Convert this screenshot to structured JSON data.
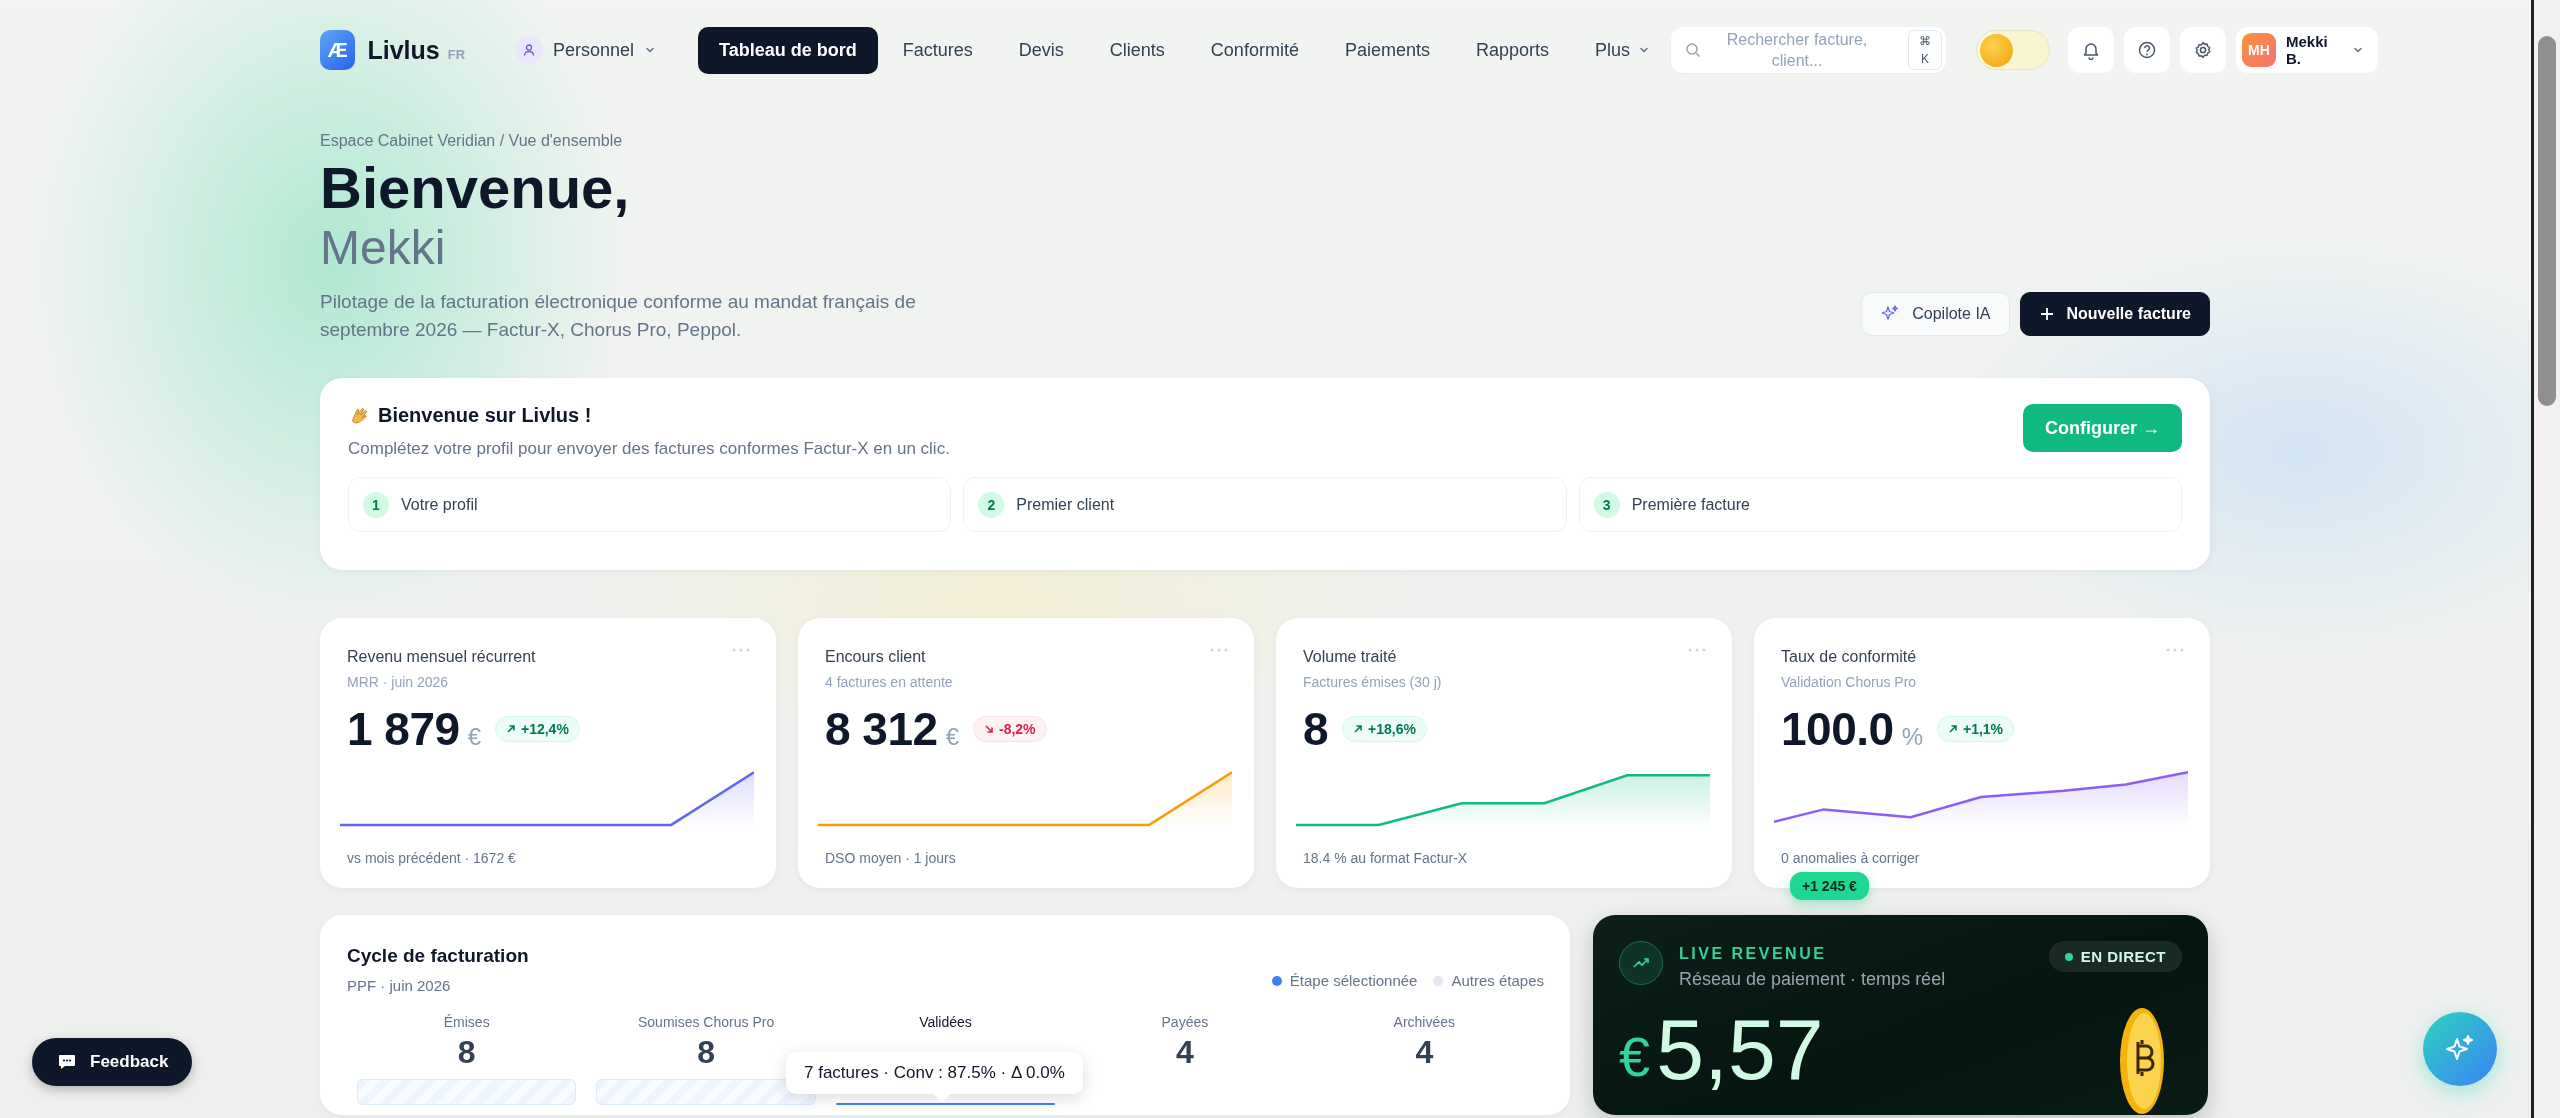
{
  "brand": {
    "logo": "Æ",
    "name": "Livlus",
    "locale": "FR"
  },
  "workspace": {
    "label": "Personnel"
  },
  "nav": [
    {
      "label": "Tableau de bord",
      "selected": true,
      "kind": "link"
    },
    {
      "label": "Factures",
      "selected": false,
      "kind": "link"
    },
    {
      "label": "Devis",
      "selected": false,
      "kind": "link"
    },
    {
      "label": "Clients",
      "selected": false,
      "kind": "link"
    },
    {
      "label": "Conformité",
      "selected": false,
      "kind": "link"
    },
    {
      "label": "Paiements",
      "selected": false,
      "kind": "link"
    },
    {
      "label": "Rapports",
      "selected": false,
      "kind": "link"
    },
    {
      "label": "Plus",
      "selected": false,
      "kind": "menu"
    }
  ],
  "search": {
    "placeholder": "Rechercher facture, client...",
    "shortcut": "⌘ K"
  },
  "theme_toggle": {
    "on": false
  },
  "user": {
    "initials": "MH",
    "name": "Mekki B."
  },
  "header": {
    "breadcrumb": "Espace Cabinet Veridian / Vue d'ensemble",
    "title": "Bienvenue,",
    "name": "Mekki",
    "description": "Pilotage de la facturation électronique conforme au mandat français de septembre 2026 — Factur-X, Chorus Pro, Peppol.",
    "actions": [
      {
        "label": "Copilote IA",
        "kind": "secondary"
      },
      {
        "label": "Nouvelle facture",
        "kind": "primary"
      }
    ]
  },
  "onboarding": {
    "title": "Bienvenue sur Livlus !",
    "subtitle": "Complétez votre profil pour envoyer des factures conformes Factur-X en un clic.",
    "button": "Configurer →",
    "steps": [
      {
        "number": "1",
        "label": "Votre profil"
      },
      {
        "number": "2",
        "label": "Premier client"
      },
      {
        "number": "3",
        "label": "Première facture"
      }
    ]
  },
  "kpis": [
    {
      "title": "Revenu mensuel récurrent",
      "subtitle": "MRR · juin 2026",
      "value": "1 879",
      "unit": "€",
      "delta": "+12,4%",
      "kind": "up",
      "footer": "vs mois précédent · 1672 €",
      "color": "#6366f1"
    },
    {
      "title": "Encours client",
      "subtitle": "4 factures en attente",
      "value": "8 312",
      "unit": "€",
      "delta": "-8,2%",
      "kind": "down",
      "footer": "DSO moyen · 1 jours",
      "color": "#f59e0b"
    },
    {
      "title": "Volume traité",
      "subtitle": "Factures émises (30 j)",
      "value": "8",
      "delta": "+18,6%",
      "kind": "up",
      "footer": "18.4 % au format Factur-X",
      "color": "#10b981"
    },
    {
      "title": "Taux de conformité",
      "subtitle": "Validation Chorus Pro",
      "value": "100.0",
      "unit": "%",
      "delta": "+1,1%",
      "kind": "up",
      "footer": "0 anomalies à corriger",
      "color": "#8b5cf6"
    }
  ],
  "floating_badge": "+1 245 €",
  "cycle": {
    "title": "Cycle de facturation",
    "subtitle": "PPF · juin 2026",
    "legend": [
      {
        "label": "Étape sélectionnée",
        "color": "#3b82f6"
      },
      {
        "label": "Autres étapes",
        "color": "#e2e8f0"
      }
    ],
    "stages": [
      {
        "label": "Émises",
        "value": "8",
        "selected": false
      },
      {
        "label": "Soumises Chorus Pro",
        "value": "8",
        "selected": false
      },
      {
        "label": "Validées",
        "selected": true
      },
      {
        "label": "Payées",
        "value": "4",
        "selected": false
      },
      {
        "label": "Archivées",
        "value": "4",
        "selected": false
      }
    ],
    "tooltip": "7 factures · Conv : 87.5% · Δ 0.0%"
  },
  "live": {
    "label": "LIVE REVENUE",
    "subtitle": "Réseau de paiement · temps réel",
    "status": "EN DIRECT",
    "currency": "€",
    "amount": "5,57"
  },
  "feedback": {
    "label": "Feedback"
  }
}
